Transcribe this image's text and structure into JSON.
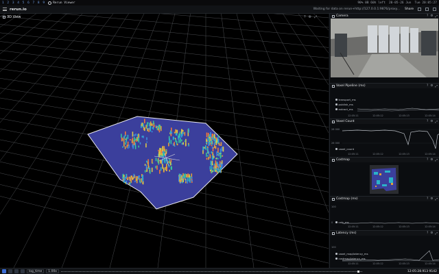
{
  "system_bar": {
    "workspaces": "1 2 3 4 5 6 7 8 9",
    "app_name": "Rerun Viewer",
    "status_items": [
      "90% 0B 60h left",
      "20-05-26 Jun",
      "Tue 20:05:27"
    ]
  },
  "header": {
    "app_title": "rerun.io",
    "status": "Waiting for data on rerun+http://127.0.0.1:9876/proxy...",
    "share_label": "Share"
  },
  "view3d": {
    "title": "3D View",
    "tools": [
      "?",
      "⚙",
      "⤢"
    ]
  },
  "panels": [
    {
      "title": "Camera"
    },
    {
      "title": "Voxel Pipeline (ms)",
      "legend": [
        "transport_ms",
        "publish_ms",
        "extract_ms"
      ],
      "x_ticks": [
        "12:05:11",
        "12:05:12",
        "12:05:13",
        "12:05:14"
      ]
    },
    {
      "title": "Voxel Count",
      "y_ticks": [
        "28 000",
        "26 000"
      ],
      "legend": [
        "voxel_count"
      ],
      "x_ticks": [
        "12:05:11",
        "12:05:12",
        "12:05:13",
        "12:05:14"
      ]
    },
    {
      "title": "Costmap"
    },
    {
      "title": "Costmap (ms)",
      "y_ticks": [
        "100",
        "0"
      ],
      "legend": [
        "calc_ms"
      ],
      "x_ticks": [
        "12:05:11",
        "12:05:12",
        "12:05:13",
        "12:05:14"
      ]
    },
    {
      "title": "Latency (ms)",
      "y_ticks": [
        "100"
      ],
      "legend": [
        "voxel_map/latency_ms",
        "costmap/latency_ms"
      ],
      "x_ticks": [
        "12:05:11",
        "12:05:12",
        "12:05:13",
        "12:05:14"
      ]
    }
  ],
  "timeline": {
    "timeline_name": "log_time",
    "speed": "1.00x",
    "current_time": "12:05:28.913 9142"
  },
  "colors": {
    "accent": "#3c6ed6",
    "floor": "#3b3f9c",
    "grid": "#8a8f96"
  }
}
